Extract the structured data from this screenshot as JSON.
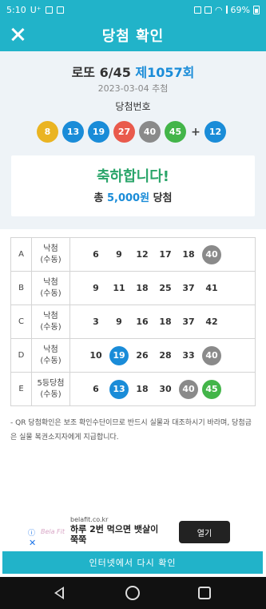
{
  "statusbar": {
    "time": "5:10",
    "carrier": "U⁺",
    "battery": "69%"
  },
  "header": {
    "title": "당첨 확인"
  },
  "result": {
    "lotto_name": "로또 6/45",
    "round": "제1057회",
    "date": "2023-03-04 추첨",
    "numbers_label": "당첨번호",
    "numbers": [
      8,
      13,
      19,
      27,
      40,
      45
    ],
    "bonus": 12,
    "plus": "+",
    "congrats": "축하합니다!",
    "prize_prefix": "총",
    "prize_amount": "5,000원",
    "prize_suffix": "당첨"
  },
  "games": [
    {
      "label": "A",
      "mode": [
        "낙첨",
        "(수동)"
      ],
      "numbers": [
        6,
        9,
        12,
        17,
        18,
        40
      ],
      "hits": [
        40
      ]
    },
    {
      "label": "B",
      "mode": [
        "낙첨",
        "(수동)"
      ],
      "numbers": [
        9,
        11,
        18,
        25,
        37,
        41
      ],
      "hits": []
    },
    {
      "label": "C",
      "mode": [
        "낙첨",
        "(수동)"
      ],
      "numbers": [
        3,
        9,
        16,
        18,
        37,
        42
      ],
      "hits": []
    },
    {
      "label": "D",
      "mode": [
        "낙첨",
        "(수동)"
      ],
      "numbers": [
        10,
        19,
        26,
        28,
        33,
        40
      ],
      "hits": [
        19,
        40
      ]
    },
    {
      "label": "E",
      "mode": [
        "5등당첨",
        "(수동)"
      ],
      "numbers": [
        6,
        13,
        18,
        30,
        40,
        45
      ],
      "hits": [
        13,
        40,
        45
      ]
    }
  ],
  "note": "- QR 당첨확인은 보조 확인수단이므로 반드시 실물과 대조하시기 바라며, 당첨금은 실물 복권소지자에게 지급합니다.",
  "ad": {
    "domain": "belafit.co.kr",
    "text": "하루 2번 먹으면 뱃살이 쭉쭉",
    "button": "열기",
    "logo": "Bela Fit",
    "info": "ⓘ",
    "close": "✕"
  },
  "recheck_button": "인터넷에서 다시 확인",
  "colors": {
    "accent": "#21b3c9",
    "ball_1_10": "#eab422",
    "ball_11_20": "#1a8cd8",
    "ball_21_30": "#e95a4c",
    "ball_31_40": "#8a8a8a",
    "ball_41_45": "#43b549",
    "congrats": "#2aa56a"
  }
}
